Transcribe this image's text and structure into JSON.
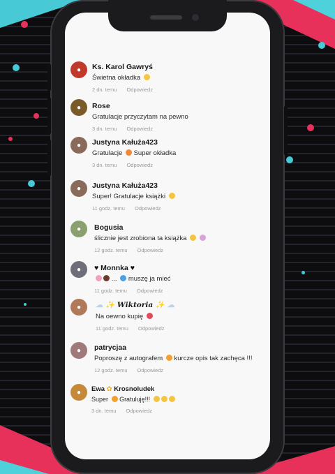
{
  "comments": [
    {
      "name": "Ks. Karol Gawryś",
      "text": "Świetna okładka",
      "time": "2 dn. temu",
      "reply": "Odpowiedz",
      "avatar_color": "#c0392b"
    },
    {
      "name": "Rose",
      "text": "Gratulacje przyczytam na pewno",
      "time": "3 dn. temu",
      "reply": "Odpowiedz",
      "avatar_color": "#7a5a2a"
    },
    {
      "name": "Justyna Kałuża423",
      "text_a": "Gratulacje",
      "text_b": "Super okładka",
      "time": "3 dn. temu",
      "reply": "Odpowiedz",
      "avatar_color": "#8a6a5a"
    },
    {
      "name": "Justyna Kałuża423",
      "text": "Super! Gratulacje książki",
      "time": "11 godz. temu",
      "reply": "Odpowiedz",
      "avatar_color": "#8a6a5a"
    },
    {
      "name": "Bogusia",
      "text": "ślicznie jest zrobiona ta książka",
      "time": "12 godz. temu",
      "reply": "Odpowiedz",
      "avatar_color": "#8aa070"
    },
    {
      "name": "Monnka",
      "text_a": "...",
      "text_b": "muszę ja mieć",
      "time": "11 godz. temu",
      "reply": "Odpowiedz",
      "avatar_color": "#6e6e7a"
    },
    {
      "name": "𝑾𝒊𝒌𝒕𝒐𝒓𝒊𝒂",
      "text": "Na oewno kupię",
      "time": "11 godz. temu",
      "reply": "Odpowiedz",
      "avatar_color": "#b07a5a"
    },
    {
      "name": "patrycjaa",
      "text_a": "Poproszę z autografem",
      "text_b": "kurcze opis tak zachęca !!!",
      "time": "12 godz. temu",
      "reply": "Odpowiedz",
      "avatar_color": "#a07a7a"
    },
    {
      "name": "Ewa",
      "name_b": "Krosnoludek",
      "text_a": "Super",
      "text_b": "Gratuluję!!!",
      "time": "3 dn. temu",
      "reply": "Odpowiedz",
      "avatar_color": "#c48a3a"
    }
  ]
}
